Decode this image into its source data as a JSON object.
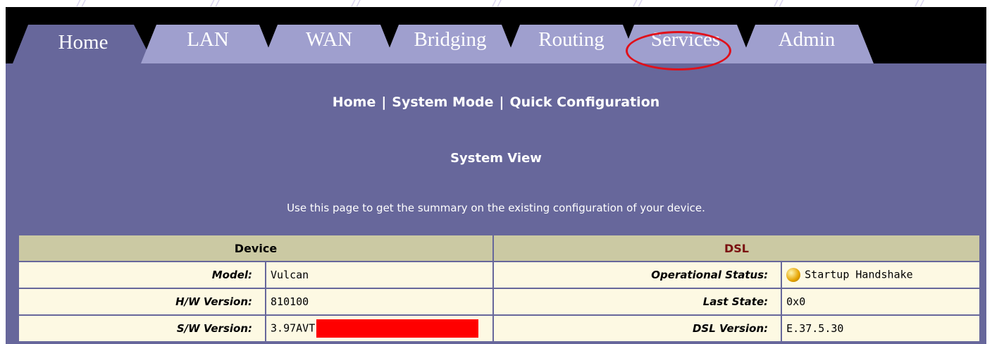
{
  "tabs": [
    {
      "label": "Home",
      "active": true
    },
    {
      "label": "LAN",
      "active": false
    },
    {
      "label": "WAN",
      "active": false
    },
    {
      "label": "Bridging",
      "active": false
    },
    {
      "label": "Routing",
      "active": false
    },
    {
      "label": "Services",
      "active": false,
      "highlighted": true
    },
    {
      "label": "Admin",
      "active": false
    }
  ],
  "subnav": {
    "items": [
      "Home",
      "System Mode",
      "Quick Configuration"
    ],
    "separator": "|"
  },
  "page": {
    "title": "System View",
    "description": "Use this page to get the summary on the existing configuration of your device."
  },
  "device": {
    "header": "Device",
    "rows": [
      {
        "key": "Model:",
        "value": "Vulcan"
      },
      {
        "key": "H/W Version:",
        "value": "810100"
      },
      {
        "key": "S/W Version:",
        "value": "3.97AVT",
        "redacted": true
      }
    ]
  },
  "dsl": {
    "header": "DSL",
    "rows": [
      {
        "key": "Operational Status:",
        "value": "Startup Handshake",
        "icon": "status-yellow-icon"
      },
      {
        "key": "Last State:",
        "value": "0x0"
      },
      {
        "key": "DSL Version:",
        "value": "E.37.5.30"
      }
    ]
  },
  "colors": {
    "panel": "#67679b",
    "tab_active": "#67679b",
    "tab_inactive": "#9f9fce",
    "table_header": "#cbc9a3",
    "table_cell": "#fdf9e3",
    "dsl_header_text": "#7a1010",
    "highlight_circle": "#e0101a",
    "redaction": "#ff0000"
  }
}
